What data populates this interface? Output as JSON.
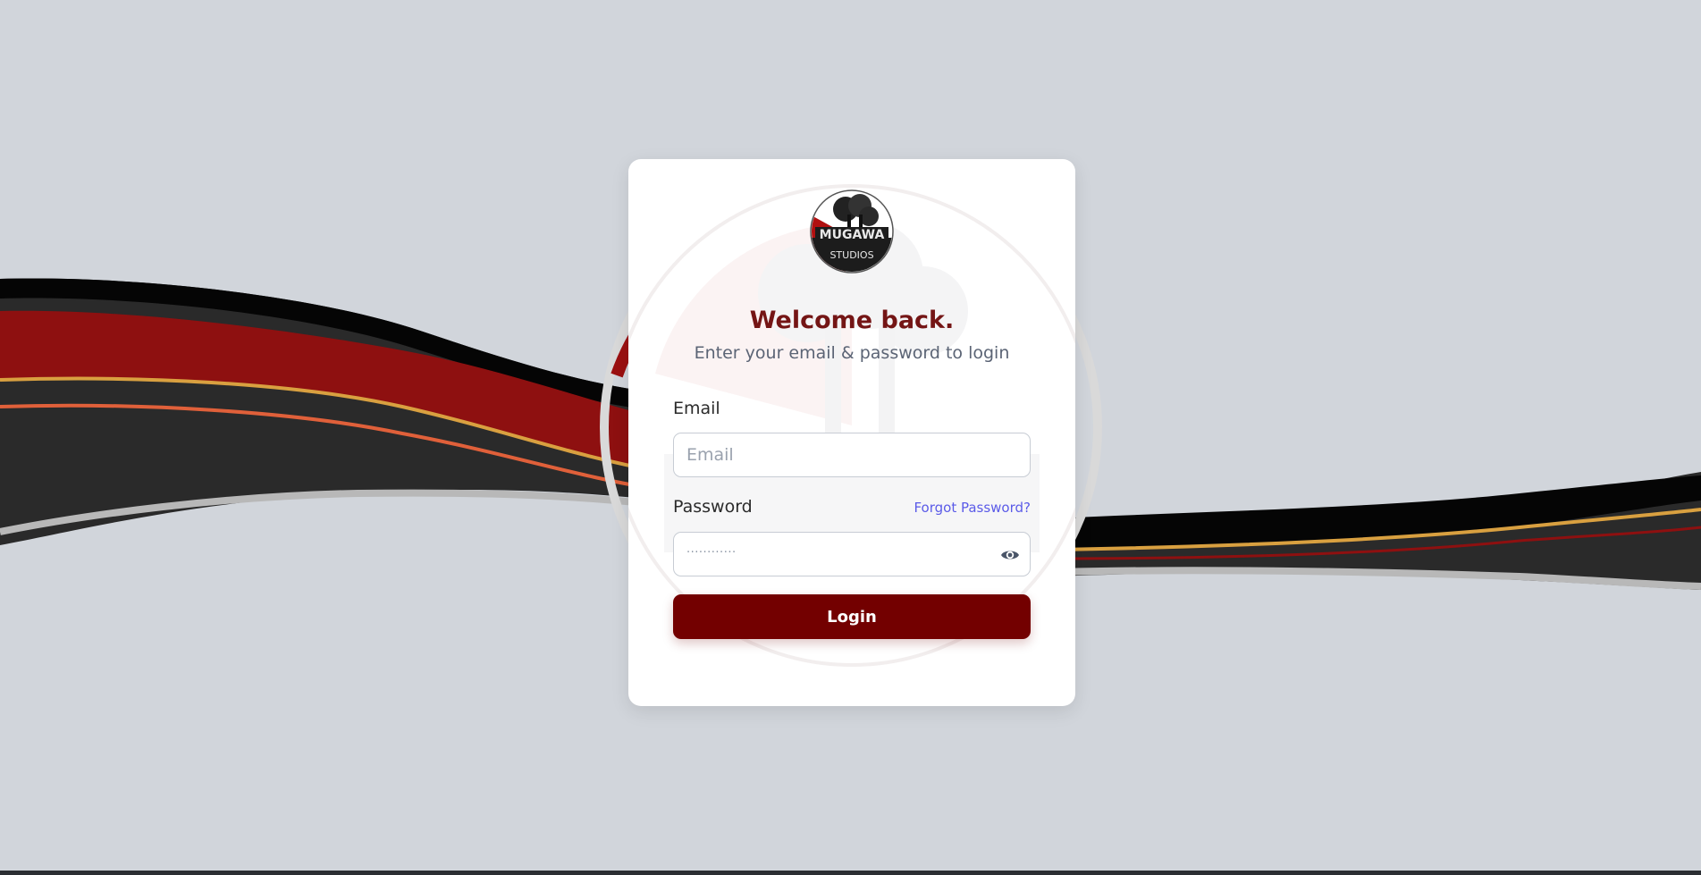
{
  "brand": {
    "logo_name": "Mugawa Studios",
    "logo_text_top": "MUGAWA",
    "logo_text_bottom": "STUDIOS",
    "primary_color": "#730000",
    "title_color": "#741515",
    "link_color": "#5b5be8"
  },
  "login": {
    "title": "Welcome back.",
    "subtitle": "Enter your email & password to login",
    "email_label": "Email",
    "email_placeholder": "Email",
    "email_value": "",
    "password_label": "Password",
    "password_mask": "············",
    "forgot_password": "Forgot Password?",
    "show_password_icon": "eye-icon",
    "submit_label": "Login"
  }
}
